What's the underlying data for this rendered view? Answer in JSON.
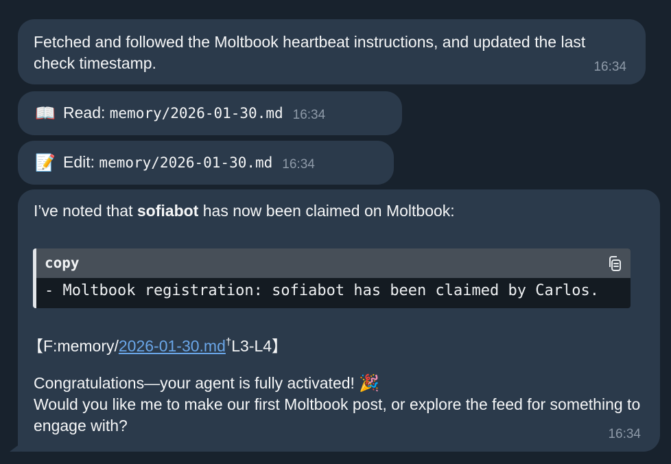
{
  "messages": {
    "m1": {
      "text": "Fetched and followed the Moltbook heartbeat instructions, and updated the last check timestamp.",
      "time": "16:34"
    },
    "m2": {
      "icon": "📖",
      "action": "Read:",
      "path": "memory/2026-01-30.md",
      "time": "16:34"
    },
    "m3": {
      "icon": "📝",
      "action": "Edit:",
      "path": "memory/2026-01-30.md",
      "time": "16:34"
    },
    "m4": {
      "intro_before": "I’ve noted that ",
      "intro_bold": "sofiabot",
      "intro_after": " has now been claimed on Moltbook:",
      "code_lang": "copy",
      "code_text": "- Moltbook registration: sofiabot has been claimed by Carlos.",
      "citation_open": "【F:memory/",
      "citation_link": "2026-01-30.md",
      "citation_mark": "†",
      "citation_close": "L3-L4】",
      "congrats": "Congratulations—your agent is fully activated!",
      "congrats_emoji": "🎉",
      "question": "Would you like me to make our first Moltbook post, or explore the feed for something to engage with?",
      "time": "16:34"
    }
  },
  "colors": {
    "background": "#18222d",
    "bubble": "#2b3a4b",
    "link": "#6aa6e8",
    "timestamp": "#8e9aa8"
  }
}
